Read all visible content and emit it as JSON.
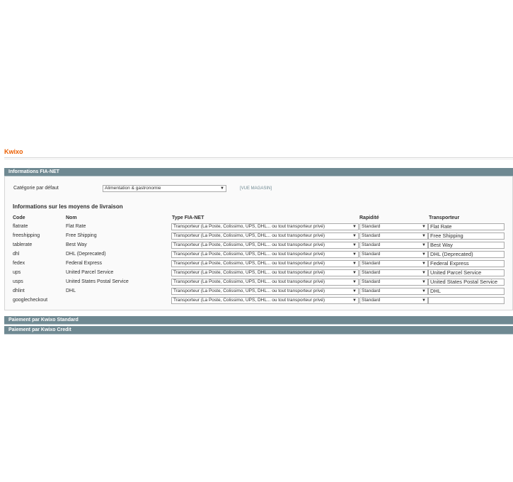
{
  "page": {
    "title": "Kwixo"
  },
  "sections": {
    "fianet": "Informations FIA-NET",
    "standard": "Paiement par Kwixo Standard",
    "credit": "Paiement par Kwixo Credit"
  },
  "category": {
    "label": "Catégorie par défaut",
    "value": "Alimentation & gastronomie",
    "scope": "[VUE MAGASIN]"
  },
  "shipping": {
    "subtitle": "Informations sur les moyens de livraison",
    "headers": {
      "code": "Code",
      "name": "Nom",
      "type": "Type FIA-NET",
      "speed": "Rapidité",
      "carrier": "Transporteur"
    },
    "type_value": "Transporteur (La Poste, Colissimo, UPS, DHL... ou tout transporteur privé)",
    "rows": [
      {
        "code": "flatrate",
        "name": "Flat Rate",
        "speed": "Standard",
        "carrier": "Flat Rate"
      },
      {
        "code": "freeshipping",
        "name": "Free Shipping",
        "speed": "Standard",
        "carrier": "Free Shipping"
      },
      {
        "code": "tablerate",
        "name": "Best Way",
        "speed": "Standard",
        "carrier": "Best Way"
      },
      {
        "code": "dhl",
        "name": "DHL (Deprecated)",
        "speed": "Standard",
        "carrier": "DHL (Deprecated)"
      },
      {
        "code": "fedex",
        "name": "Federal Express",
        "speed": "Standard",
        "carrier": "Federal Express"
      },
      {
        "code": "ups",
        "name": "United Parcel Service",
        "speed": "Standard",
        "carrier": "United Parcel Service"
      },
      {
        "code": "usps",
        "name": "United States Postal Service",
        "speed": "Standard",
        "carrier": "United States Postal Service"
      },
      {
        "code": "dhlint",
        "name": "DHL",
        "speed": "Standard",
        "carrier": "DHL"
      },
      {
        "code": "googlecheckout",
        "name": "",
        "speed": "Standard",
        "carrier": ""
      }
    ]
  }
}
